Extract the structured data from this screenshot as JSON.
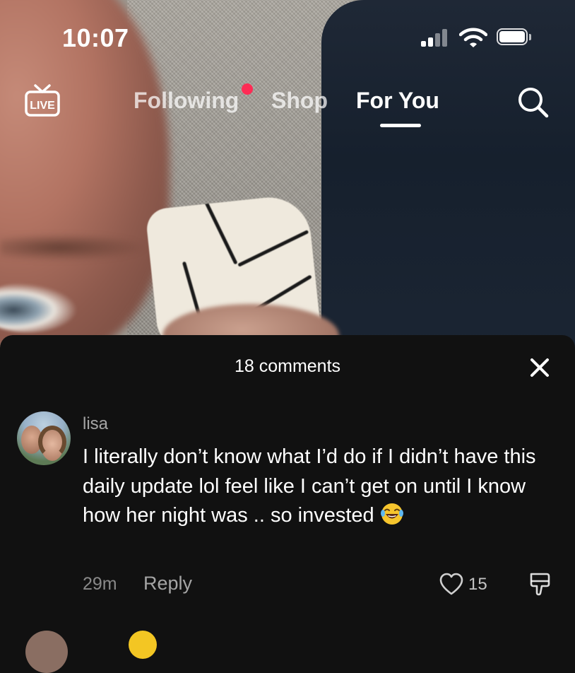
{
  "status_bar": {
    "time": "10:07"
  },
  "top_nav": {
    "live_label": "LIVE",
    "tabs": [
      {
        "label": "Following",
        "active": false,
        "has_notification_dot": true
      },
      {
        "label": "Shop",
        "active": false
      },
      {
        "label": "For You",
        "active": true
      }
    ]
  },
  "comments_panel": {
    "title": "18 comments",
    "comments": [
      {
        "username": "lisa",
        "text": "I literally don’t know what I’d do if I didn’t have this daily update lol feel like I can’t get on until I know how her night was .. so invested",
        "emoji": "😂",
        "time": "29m",
        "reply_label": "Reply",
        "like_count": "15"
      }
    ]
  },
  "colors": {
    "sheet_background": "#111111",
    "notification_dot": "#fe2c55",
    "text_primary": "#ffffff"
  },
  "icons": [
    "live-icon",
    "search-icon",
    "close-icon",
    "heart-icon",
    "dislike-icon",
    "signal-icon",
    "wifi-icon",
    "battery-icon"
  ]
}
